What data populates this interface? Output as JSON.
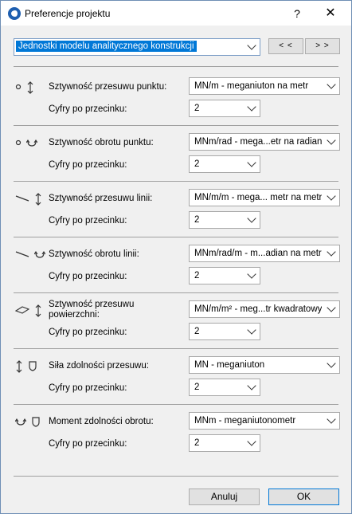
{
  "window": {
    "title": "Preferencje projektu",
    "help": "?",
    "close": "✕"
  },
  "top": {
    "category": "Jednostki modelu analitycznego konstrukcji",
    "prev": "< <",
    "next": "> >"
  },
  "digits_label": "Cyfry po przecinku:",
  "sections": [
    {
      "label": "Sztywność przesuwu punktu:",
      "unit": "MN/m - meganiuton na metr",
      "digits": "2",
      "icons": [
        "point-icon",
        "translation-arrow-icon"
      ]
    },
    {
      "label": "Sztywność obrotu punktu:",
      "unit": "MNm/rad - mega...etr na radian",
      "digits": "2",
      "icons": [
        "point-icon",
        "rotation-icon"
      ]
    },
    {
      "label": "Sztywność przesuwu linii:",
      "unit": "MN/m/m - mega... metr na metr",
      "digits": "2",
      "icons": [
        "line-icon",
        "translation-arrow-icon"
      ]
    },
    {
      "label": "Sztywność obrotu linii:",
      "unit": "MNm/rad/m - m...adian na metr",
      "digits": "2",
      "icons": [
        "line-icon",
        "rotation-icon"
      ]
    },
    {
      "label_line1": "Sztywność przesuwu",
      "label_line2": "powierzchni:",
      "unit": "MN/m/m² - meg...tr kwadratowy",
      "digits": "2",
      "icons": [
        "surface-icon",
        "translation-arrow-icon"
      ]
    },
    {
      "label": "Siła zdolności przesuwu:",
      "unit": "MN - meganiuton",
      "digits": "2",
      "icons": [
        "translation-arrow-icon",
        "shield-icon"
      ]
    },
    {
      "label": "Moment zdolności obrotu:",
      "unit": "MNm - meganiutonometr",
      "digits": "2",
      "icons": [
        "rotation-icon",
        "shield-icon"
      ]
    }
  ],
  "footer": {
    "cancel": "Anuluj",
    "ok": "OK"
  }
}
